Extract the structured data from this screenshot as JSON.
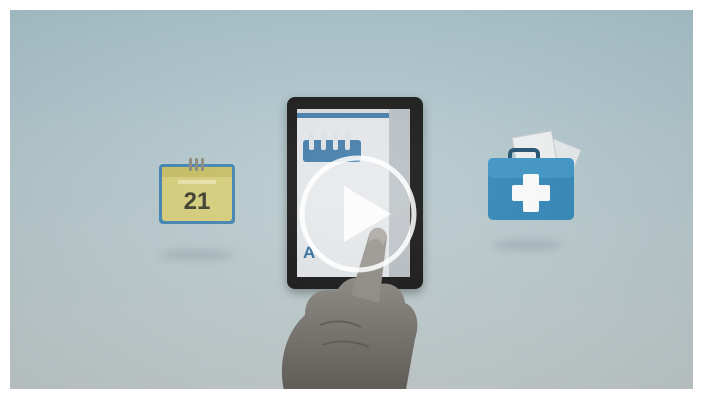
{
  "video": {
    "calendar_day": "21",
    "tablet_screen_text": "A",
    "controls": {
      "play_button": "play-icon"
    }
  },
  "icons": {
    "calendar": "calendar-icon",
    "medical_kit": "medical-kit-icon",
    "hand": "hand-image"
  },
  "colors": {
    "background_top": "#a9c4cc",
    "background_bottom": "#c3cccd",
    "medkit_blue": "#2f86b8",
    "calendar_yellow": "#d8cf7a",
    "calendar_blue": "#3f83b3",
    "play_overlay": "#ffffff"
  }
}
